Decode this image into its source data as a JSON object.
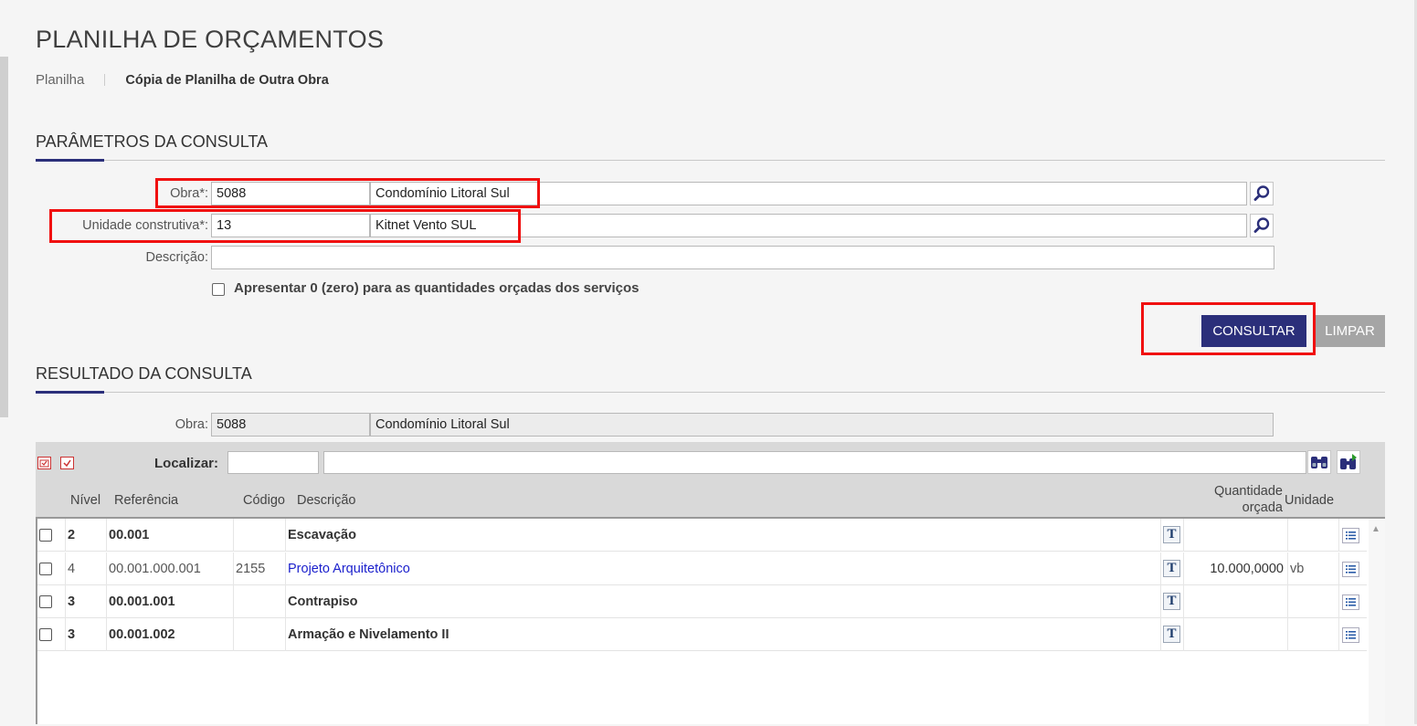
{
  "page": {
    "title": "PLANILHA DE ORÇAMENTOS",
    "breadcrumb": [
      "Planilha",
      "Cópia de Planilha de Outra Obra"
    ]
  },
  "params": {
    "section_title": "PARÂMETROS DA CONSULTA",
    "obra": {
      "label": "Obra*:",
      "code": "5088",
      "name": "Condomínio Litoral Sul"
    },
    "unidade": {
      "label": "Unidade construtiva*:",
      "code": "13",
      "name": "Kitnet Vento SUL"
    },
    "descricao": {
      "label": "Descrição:",
      "value": ""
    },
    "zero_option": {
      "label": "Apresentar 0 (zero) para as quantidades orçadas dos serviços",
      "checked": false
    },
    "consultar_label": "CONSULTAR",
    "limpar_label": "LIMPAR"
  },
  "result": {
    "section_title": "RESULTADO DA CONSULTA",
    "obra": {
      "label": "Obra:",
      "code": "5088",
      "name": "Condomínio Litoral Sul"
    },
    "localizar_label": "Localizar:",
    "columns": {
      "nivel": "Nível",
      "referencia": "Referência",
      "codigo": "Código",
      "descricao": "Descrição",
      "quantidade_line1": "Quantidade",
      "quantidade_line2": "orçada",
      "unidade": "Unidade"
    },
    "rows": [
      {
        "nivel": "2",
        "referencia": "00.001",
        "codigo": "",
        "descricao": "Escavação",
        "quantidade": "",
        "unidade": "",
        "bold": true
      },
      {
        "nivel": "4",
        "referencia": "00.001.000.001",
        "codigo": "2155",
        "descricao": "Projeto Arquitetônico",
        "quantidade": "10.000,0000",
        "unidade": "vb",
        "bold": false
      },
      {
        "nivel": "3",
        "referencia": "00.001.001",
        "codigo": "",
        "descricao": "Contrapiso",
        "quantidade": "",
        "unidade": "",
        "bold": true
      },
      {
        "nivel": "3",
        "referencia": "00.001.002",
        "codigo": "",
        "descricao": "Armação e Nivelamento II",
        "quantidade": "",
        "unidade": "",
        "bold": true
      }
    ]
  },
  "icons": {
    "search": "magnifier-icon",
    "binoculars": "binoculars-icon",
    "text": "T-icon",
    "list": "list-icon"
  },
  "colors": {
    "primary": "#2b2f7a",
    "highlight": "#f01010",
    "link": "#1a1fcc",
    "disabled_button": "#a5a5a5"
  }
}
